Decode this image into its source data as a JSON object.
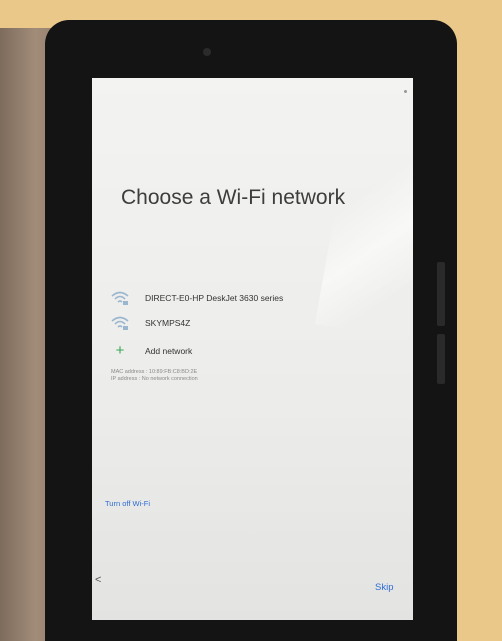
{
  "screen": {
    "title": "Choose a Wi‑Fi network",
    "networks": [
      {
        "name": "DIRECT-E0-HP DeskJet 3630 series",
        "icon": "wifi-lock-icon"
      },
      {
        "name": "SKYMPS4Z",
        "icon": "wifi-lock-icon"
      }
    ],
    "add_network": {
      "label": "Add network",
      "icon": "plus-icon"
    },
    "info": {
      "mac_address": "MAC address : 10:89:FB:C8:BD:2E",
      "ip_address": "IP address : No network connection"
    },
    "turn_off_wifi": "Turn off Wi-Fi",
    "back_icon": "<",
    "skip": "Skip"
  },
  "colors": {
    "accent": "#2d6bd4",
    "plus": "#3aa757",
    "wifi_icon": "#9bb6cf"
  }
}
